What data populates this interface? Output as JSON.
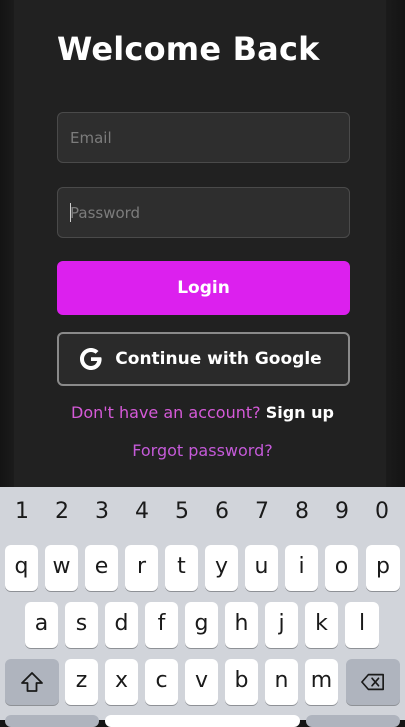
{
  "login": {
    "title": "Welcome Back",
    "email_placeholder": "Email",
    "password_placeholder": "Password",
    "login_label": "Login",
    "google_label": "Continue with Google",
    "signup_prompt": "Don't have an account?",
    "signup_link": "Sign up",
    "forgot_password": "Forgot password?"
  },
  "keyboard": {
    "numbers": [
      "1",
      "2",
      "3",
      "4",
      "5",
      "6",
      "7",
      "8",
      "9",
      "0"
    ],
    "row1": [
      "q",
      "w",
      "e",
      "r",
      "t",
      "y",
      "u",
      "i",
      "o",
      "p"
    ],
    "row2": [
      "a",
      "s",
      "d",
      "f",
      "g",
      "h",
      "j",
      "k",
      "l"
    ],
    "row3": [
      "z",
      "x",
      "c",
      "v",
      "b",
      "n",
      "m"
    ]
  },
  "colors": {
    "accent": "#dc20ee",
    "link": "#d55ad8",
    "background": "#212121"
  }
}
